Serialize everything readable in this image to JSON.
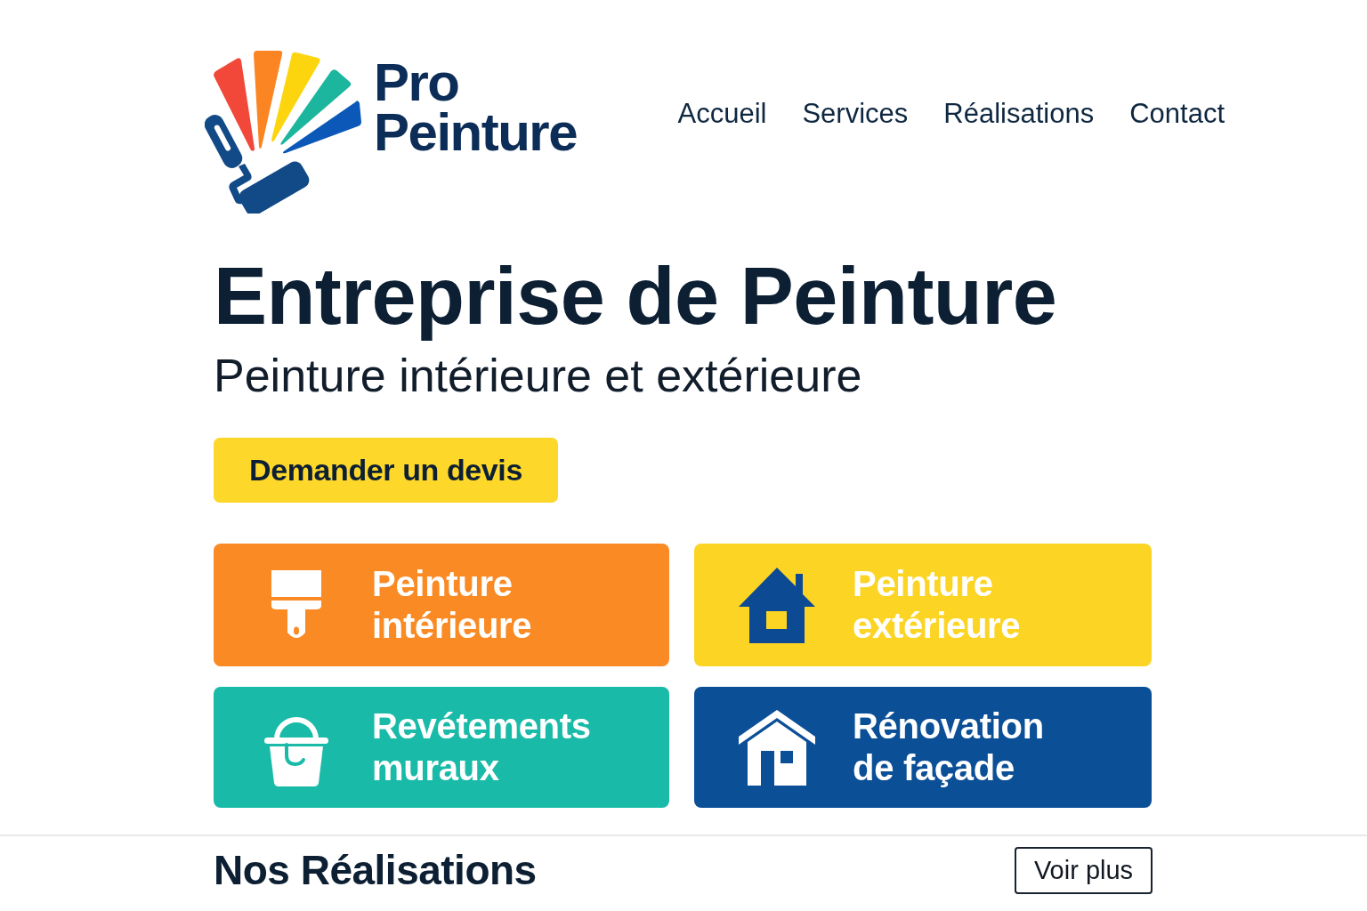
{
  "header": {
    "logo_text": "Pro Peinture",
    "nav": [
      {
        "label": "Accueil"
      },
      {
        "label": "Services"
      },
      {
        "label": "Réalisations"
      },
      {
        "label": "Contact"
      }
    ]
  },
  "hero": {
    "title": "Entreprise de Peinture",
    "subtitle": "Peinture intérieure et extérieure",
    "cta": "Demander un devis"
  },
  "services": [
    {
      "kind": "brush",
      "label": "Peinture intérieure",
      "color": "#fa8a24"
    },
    {
      "kind": "house",
      "label": "Peinture extérieure",
      "color": "#fcd424"
    },
    {
      "kind": "bucket",
      "label": "Revétements muraux",
      "color": "#19bba8"
    },
    {
      "kind": "house-outline",
      "label": "Rénovation de façade",
      "color": "#0b4f97"
    }
  ],
  "realisations": {
    "title": "Nos Réalisations",
    "button": "Voir plus"
  }
}
